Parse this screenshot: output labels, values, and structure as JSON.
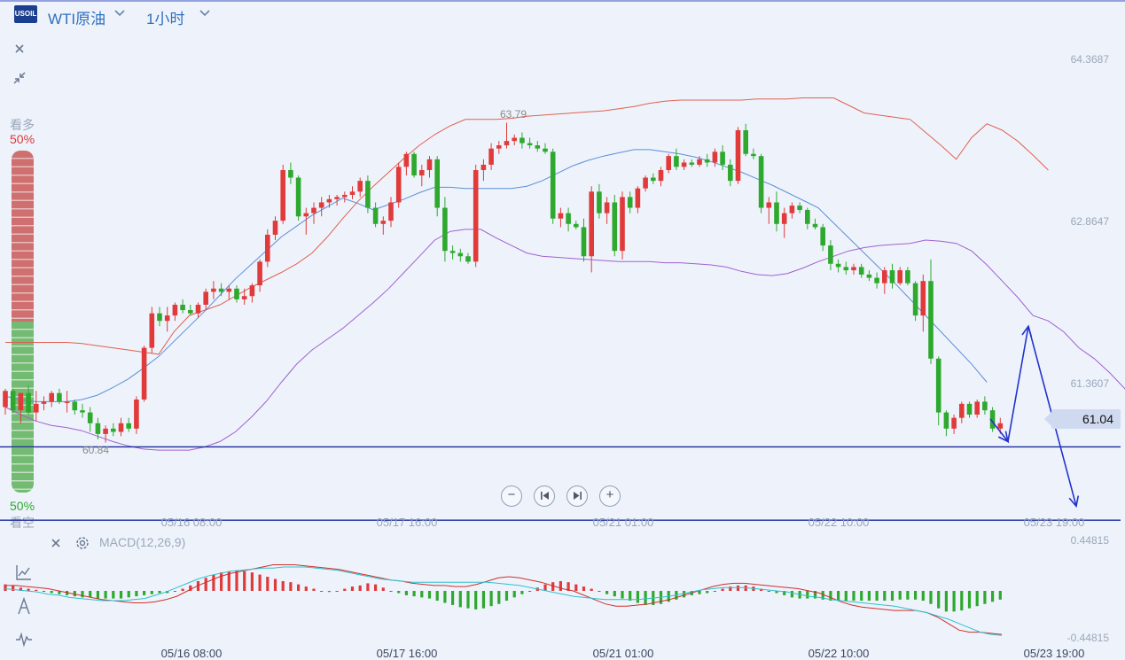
{
  "header": {
    "logo_text": "USOIL",
    "symbol": "WTI原油",
    "timeframe": "1小时"
  },
  "sentiment": {
    "bull_label": "看多",
    "bull_pct": "50%",
    "bear_label": "看空",
    "bear_pct": "50%",
    "bull_fraction": 0.5,
    "bull_color": "#c94040",
    "bear_color": "#3aa83a"
  },
  "price_tag": "61.04",
  "macd": {
    "label": "MACD(12,26,9)",
    "y_top": "0.44815",
    "y_bottom": "-0.44815"
  },
  "colors": {
    "up": "#e03a3a",
    "down": "#2ea82e",
    "upper_band": "#e06050",
    "mid_band": "#5a8fd8",
    "lower_band": "#a060d0",
    "arrow": "#2233cc"
  },
  "chart_data": {
    "type": "candlestick",
    "x_tick_labels": [
      "05/16 08:00",
      "05/17 16:00",
      "05/21 01:00",
      "05/22 10:00",
      "05/23 19:00"
    ],
    "y_tick_labels": [
      "64.3687",
      "62.8647",
      "61.3607"
    ],
    "y_ticks": [
      64.3687,
      62.8647,
      61.3607
    ],
    "ylim": [
      60.2,
      64.6
    ],
    "annotations": [
      {
        "text": "63.79",
        "value": 63.79
      },
      {
        "text": "60.84",
        "value": 60.84
      }
    ],
    "candles": [
      [
        61.15,
        61.32,
        61.08,
        61.3
      ],
      [
        61.3,
        61.32,
        61.1,
        61.12
      ],
      [
        61.12,
        61.28,
        61.0,
        61.28
      ],
      [
        61.28,
        61.35,
        61.08,
        61.1
      ],
      [
        61.1,
        61.3,
        61.02,
        61.18
      ],
      [
        61.18,
        61.25,
        61.12,
        61.2
      ],
      [
        61.2,
        61.3,
        61.15,
        61.28
      ],
      [
        61.28,
        61.32,
        61.18,
        61.2
      ],
      [
        61.2,
        61.3,
        61.1,
        61.2
      ],
      [
        61.2,
        61.22,
        61.08,
        61.12
      ],
      [
        61.12,
        61.18,
        61.05,
        61.1
      ],
      [
        61.1,
        61.15,
        60.92,
        61.0
      ],
      [
        61.0,
        61.05,
        60.85,
        60.9
      ],
      [
        60.9,
        60.98,
        60.82,
        60.95
      ],
      [
        60.95,
        61.0,
        60.88,
        60.92
      ],
      [
        60.92,
        61.05,
        60.88,
        61.0
      ],
      [
        61.0,
        61.05,
        60.92,
        60.95
      ],
      [
        60.95,
        61.25,
        60.9,
        61.22
      ],
      [
        61.22,
        61.72,
        61.2,
        61.7
      ],
      [
        61.7,
        62.08,
        61.65,
        62.02
      ],
      [
        62.02,
        62.08,
        61.9,
        61.95
      ],
      [
        61.95,
        62.08,
        61.85,
        62.0
      ],
      [
        62.0,
        62.12,
        61.95,
        62.1
      ],
      [
        62.1,
        62.15,
        62.02,
        62.05
      ],
      [
        62.05,
        62.1,
        62.0,
        62.02
      ],
      [
        62.02,
        62.12,
        61.98,
        62.1
      ],
      [
        62.1,
        62.25,
        62.05,
        62.22
      ],
      [
        62.22,
        62.32,
        62.15,
        62.25
      ],
      [
        62.25,
        62.3,
        62.18,
        62.22
      ],
      [
        62.22,
        62.28,
        62.15,
        62.25
      ],
      [
        62.25,
        62.28,
        62.12,
        62.15
      ],
      [
        62.15,
        62.25,
        62.1,
        62.18
      ],
      [
        62.18,
        62.3,
        62.12,
        62.28
      ],
      [
        62.28,
        62.52,
        62.22,
        62.5
      ],
      [
        62.5,
        62.8,
        62.45,
        62.75
      ],
      [
        62.75,
        62.92,
        62.7,
        62.88
      ],
      [
        62.88,
        63.4,
        62.85,
        63.35
      ],
      [
        63.35,
        63.42,
        63.22,
        63.28
      ],
      [
        63.28,
        63.3,
        62.88,
        62.92
      ],
      [
        62.92,
        63.0,
        62.75,
        62.95
      ],
      [
        62.95,
        63.05,
        62.85,
        63.0
      ],
      [
        63.0,
        63.1,
        62.92,
        63.05
      ],
      [
        63.05,
        63.12,
        63.0,
        63.08
      ],
      [
        63.08,
        63.12,
        63.02,
        63.1
      ],
      [
        63.1,
        63.15,
        63.05,
        63.12
      ],
      [
        63.12,
        63.2,
        63.08,
        63.15
      ],
      [
        63.15,
        63.28,
        63.1,
        63.25
      ],
      [
        63.25,
        63.3,
        62.95,
        63.0
      ],
      [
        63.0,
        63.05,
        62.82,
        62.85
      ],
      [
        62.85,
        62.92,
        62.75,
        62.88
      ],
      [
        62.88,
        63.1,
        62.82,
        63.05
      ],
      [
        63.05,
        63.42,
        63.0,
        63.38
      ],
      [
        63.38,
        63.52,
        63.3,
        63.5
      ],
      [
        63.5,
        63.52,
        63.28,
        63.3
      ],
      [
        63.3,
        63.4,
        63.2,
        63.35
      ],
      [
        63.35,
        63.48,
        63.28,
        63.45
      ],
      [
        63.45,
        63.48,
        62.92,
        63.0
      ],
      [
        63.0,
        63.1,
        62.5,
        62.6
      ],
      [
        62.6,
        62.65,
        62.52,
        62.58
      ],
      [
        62.58,
        62.62,
        62.5,
        62.55
      ],
      [
        62.55,
        62.58,
        62.48,
        62.5
      ],
      [
        62.5,
        63.4,
        62.45,
        63.35
      ],
      [
        63.35,
        63.45,
        63.25,
        63.4
      ],
      [
        63.4,
        63.6,
        63.35,
        63.55
      ],
      [
        63.55,
        63.62,
        63.5,
        63.58
      ],
      [
        63.58,
        63.79,
        63.55,
        63.62
      ],
      [
        63.62,
        63.68,
        63.58,
        63.65
      ],
      [
        63.65,
        63.7,
        63.55,
        63.6
      ],
      [
        63.6,
        63.65,
        63.55,
        63.58
      ],
      [
        63.58,
        63.62,
        63.52,
        63.55
      ],
      [
        63.55,
        63.6,
        63.5,
        63.52
      ],
      [
        63.52,
        63.55,
        62.85,
        62.9
      ],
      [
        62.9,
        63.0,
        62.82,
        62.95
      ],
      [
        62.95,
        63.0,
        62.78,
        62.85
      ],
      [
        62.85,
        62.88,
        62.8,
        62.82
      ],
      [
        62.82,
        62.9,
        62.5,
        62.55
      ],
      [
        62.55,
        63.2,
        62.4,
        63.15
      ],
      [
        63.15,
        63.22,
        62.9,
        62.95
      ],
      [
        62.95,
        63.1,
        62.85,
        63.05
      ],
      [
        63.05,
        63.12,
        62.55,
        62.6
      ],
      [
        62.6,
        63.15,
        62.52,
        63.1
      ],
      [
        63.1,
        63.15,
        62.95,
        63.0
      ],
      [
        63.0,
        63.2,
        62.95,
        63.18
      ],
      [
        63.18,
        63.3,
        63.15,
        63.28
      ],
      [
        63.28,
        63.32,
        63.22,
        63.25
      ],
      [
        63.25,
        63.38,
        63.2,
        63.35
      ],
      [
        63.35,
        63.5,
        63.32,
        63.48
      ],
      [
        63.48,
        63.55,
        63.35,
        63.38
      ],
      [
        63.38,
        63.45,
        63.35,
        63.42
      ],
      [
        63.42,
        63.45,
        63.38,
        63.4
      ],
      [
        63.4,
        63.48,
        63.38,
        63.45
      ],
      [
        63.45,
        63.5,
        63.38,
        63.42
      ],
      [
        63.42,
        63.55,
        63.38,
        63.52
      ],
      [
        63.52,
        63.58,
        63.35,
        63.4
      ],
      [
        63.4,
        63.45,
        63.2,
        63.25
      ],
      [
        63.25,
        63.75,
        63.22,
        63.72
      ],
      [
        63.72,
        63.78,
        63.48,
        63.5
      ],
      [
        63.5,
        63.55,
        63.45,
        63.48
      ],
      [
        63.48,
        63.5,
        62.95,
        63.0
      ],
      [
        63.0,
        63.1,
        62.85,
        63.05
      ],
      [
        63.05,
        63.15,
        62.78,
        62.85
      ],
      [
        62.85,
        63.0,
        62.72,
        62.95
      ],
      [
        62.95,
        63.05,
        62.9,
        63.02
      ],
      [
        63.02,
        63.05,
        62.95,
        62.98
      ],
      [
        62.98,
        63.0,
        62.8,
        62.85
      ],
      [
        62.85,
        62.9,
        62.8,
        62.82
      ],
      [
        62.82,
        62.85,
        62.6,
        62.65
      ],
      [
        62.65,
        62.7,
        62.42,
        62.48
      ],
      [
        62.48,
        62.52,
        62.4,
        62.45
      ],
      [
        62.45,
        62.5,
        62.38,
        62.42
      ],
      [
        62.42,
        62.48,
        62.38,
        62.45
      ],
      [
        62.45,
        62.48,
        62.35,
        62.38
      ],
      [
        62.38,
        62.42,
        62.32,
        62.35
      ],
      [
        62.35,
        62.4,
        62.25,
        62.3
      ],
      [
        62.3,
        62.45,
        62.2,
        62.42
      ],
      [
        62.42,
        62.48,
        62.25,
        62.3
      ],
      [
        62.3,
        62.45,
        62.28,
        62.42
      ],
      [
        62.42,
        62.45,
        62.28,
        62.3
      ],
      [
        62.3,
        62.32,
        61.95,
        62.0
      ],
      [
        62.0,
        62.38,
        61.85,
        62.32
      ],
      [
        62.32,
        62.52,
        61.55,
        61.6
      ],
      [
        61.6,
        61.62,
        60.98,
        61.1
      ],
      [
        61.1,
        61.12,
        60.88,
        60.95
      ],
      [
        60.95,
        61.08,
        60.9,
        61.05
      ],
      [
        61.05,
        61.2,
        61.0,
        61.18
      ],
      [
        61.18,
        61.2,
        61.05,
        61.08
      ],
      [
        61.08,
        61.22,
        61.05,
        61.2
      ],
      [
        61.2,
        61.25,
        61.08,
        61.12
      ],
      [
        61.12,
        61.15,
        60.92,
        60.95
      ],
      [
        60.95,
        61.05,
        60.9,
        61.0
      ]
    ],
    "upper_band": [
      61.75,
      61.75,
      61.75,
      61.75,
      61.75,
      61.74,
      61.72,
      61.7,
      61.68,
      61.66,
      61.64,
      61.85,
      62.0,
      62.05,
      62.1,
      62.18,
      62.26,
      62.33,
      62.4,
      62.48,
      62.58,
      62.73,
      62.9,
      63.06,
      63.2,
      63.33,
      63.46,
      63.58,
      63.68,
      63.76,
      63.82,
      63.82,
      63.82,
      63.83,
      63.85,
      63.86,
      63.87,
      63.88,
      63.89,
      63.9,
      63.92,
      63.94,
      63.97,
      63.99,
      64.0,
      64.0,
      64.0,
      64.0,
      64.0,
      64.01,
      64.01,
      64.01,
      64.02,
      64.02,
      64.02,
      63.95,
      63.88,
      63.86,
      63.84,
      63.82,
      63.7,
      63.58,
      63.45,
      63.65,
      63.78,
      63.72,
      63.62,
      63.49,
      63.35
    ],
    "mid_band": [
      61.25,
      61.22,
      61.2,
      61.2,
      61.2,
      61.22,
      61.26,
      61.33,
      61.41,
      61.51,
      61.62,
      61.76,
      61.9,
      62.04,
      62.19,
      62.34,
      62.47,
      62.6,
      62.73,
      62.83,
      62.93,
      63.01,
      63.09,
      63.04,
      62.98,
      63.03,
      63.08,
      63.14,
      63.19,
      63.19,
      63.18,
      63.18,
      63.18,
      63.18,
      63.2,
      63.25,
      63.32,
      63.39,
      63.44,
      63.48,
      63.51,
      63.54,
      63.54,
      63.52,
      63.5,
      63.47,
      63.43,
      63.38,
      63.33,
      63.27,
      63.21,
      63.14,
      63.07,
      63.0,
      62.86,
      62.72,
      62.58,
      62.44,
      62.3,
      62.15,
      62.0,
      61.85,
      61.7,
      61.55,
      61.38
    ],
    "lower_band": [
      61.15,
      61.08,
      61.02,
      60.98,
      60.96,
      60.93,
      60.88,
      60.83,
      60.79,
      60.76,
      60.75,
      60.75,
      60.75,
      60.78,
      60.83,
      60.92,
      61.05,
      61.2,
      61.38,
      61.55,
      61.68,
      61.78,
      61.88,
      62.0,
      62.12,
      62.25,
      62.4,
      62.55,
      62.7,
      62.78,
      62.8,
      62.8,
      62.72,
      62.65,
      62.58,
      62.55,
      62.54,
      62.53,
      62.52,
      62.51,
      62.5,
      62.5,
      62.5,
      62.49,
      62.49,
      62.48,
      62.47,
      62.45,
      62.41,
      62.38,
      62.37,
      62.39,
      62.44,
      62.5,
      62.55,
      62.6,
      62.63,
      62.65,
      62.66,
      62.67,
      62.7,
      62.69,
      62.67,
      62.6,
      62.47,
      62.32,
      62.17,
      62.0,
      61.95,
      61.85,
      61.7,
      61.6,
      61.47,
      61.32,
      61.0,
      60.78,
      60.55
    ],
    "forecast_arrow": [
      [
        61.04,
        61.04
      ],
      [
        60.83,
        61.9
      ],
      [
        61.9,
        60.23
      ]
    ],
    "horizontal_lines": [
      60.78,
      60.1
    ],
    "macd": {
      "ylim": [
        -0.44815,
        0.44815
      ],
      "histogram": [
        0.06,
        0.05,
        0.03,
        0.02,
        0.01,
        0.0,
        -0.02,
        -0.03,
        -0.04,
        -0.05,
        -0.06,
        -0.06,
        -0.07,
        -0.07,
        -0.07,
        -0.07,
        -0.06,
        -0.05,
        -0.04,
        -0.03,
        -0.02,
        -0.02,
        0.0,
        0.02,
        0.05,
        0.09,
        0.12,
        0.15,
        0.17,
        0.18,
        0.19,
        0.18,
        0.17,
        0.15,
        0.13,
        0.11,
        0.09,
        0.08,
        0.06,
        0.04,
        0.02,
        0.0,
        -0.01,
        0.0,
        0.02,
        0.04,
        0.05,
        0.07,
        0.06,
        0.03,
        0.0,
        -0.02,
        -0.04,
        -0.05,
        -0.06,
        -0.07,
        -0.09,
        -0.11,
        -0.13,
        -0.15,
        -0.16,
        -0.17,
        -0.16,
        -0.14,
        -0.12,
        -0.09,
        -0.06,
        -0.03,
        0.0,
        0.03,
        0.06,
        0.08,
        0.09,
        0.08,
        0.06,
        0.04,
        0.02,
        0.0,
        -0.03,
        -0.05,
        -0.07,
        -0.09,
        -0.11,
        -0.13,
        -0.13,
        -0.12,
        -0.1,
        -0.08,
        -0.06,
        -0.04,
        -0.03,
        -0.02,
        0.0,
        0.02,
        0.04,
        0.05,
        0.05,
        0.04,
        0.02,
        0.0,
        -0.02,
        -0.04,
        -0.06,
        -0.07,
        -0.07,
        -0.07,
        -0.08,
        -0.09,
        -0.09,
        -0.09,
        -0.09,
        -0.09,
        -0.09,
        -0.09,
        -0.09,
        -0.09,
        -0.08,
        -0.08,
        -0.08,
        -0.09,
        -0.12,
        -0.16,
        -0.19,
        -0.19,
        -0.18,
        -0.16,
        -0.14,
        -0.12,
        -0.1,
        -0.08
      ],
      "macd_line": [
        0.05,
        0.05,
        0.04,
        0.03,
        0.02,
        0.0,
        -0.02,
        -0.04,
        -0.06,
        -0.08,
        -0.09,
        -0.1,
        -0.11,
        -0.11,
        -0.1,
        -0.08,
        -0.05,
        0.0,
        0.05,
        0.09,
        0.13,
        0.16,
        0.18,
        0.2,
        0.22,
        0.24,
        0.24,
        0.24,
        0.23,
        0.22,
        0.21,
        0.2,
        0.18,
        0.16,
        0.14,
        0.12,
        0.1,
        0.09,
        0.07,
        0.06,
        0.05,
        0.05,
        0.04,
        0.04,
        0.06,
        0.09,
        0.12,
        0.13,
        0.12,
        0.1,
        0.08,
        0.05,
        0.02,
        0.0,
        -0.04,
        -0.08,
        -0.12,
        -0.14,
        -0.14,
        -0.13,
        -0.12,
        -0.1,
        -0.08,
        -0.05,
        -0.02,
        0.01,
        0.04,
        0.06,
        0.07,
        0.07,
        0.06,
        0.05,
        0.04,
        0.03,
        0.02,
        0.0,
        -0.02,
        -0.06,
        -0.1,
        -0.13,
        -0.15,
        -0.16,
        -0.17,
        -0.18,
        -0.18,
        -0.18,
        -0.2,
        -0.24,
        -0.3,
        -0.36,
        -0.38,
        -0.38,
        -0.39,
        -0.4
      ],
      "signal_line": [
        0.02,
        0.01,
        0.0,
        -0.01,
        -0.03,
        -0.04,
        -0.06,
        -0.07,
        -0.08,
        -0.09,
        -0.09,
        -0.09,
        -0.08,
        -0.07,
        -0.04,
        -0.01,
        0.03,
        0.07,
        0.11,
        0.14,
        0.16,
        0.18,
        0.19,
        0.2,
        0.21,
        0.21,
        0.22,
        0.22,
        0.22,
        0.21,
        0.2,
        0.19,
        0.17,
        0.15,
        0.13,
        0.11,
        0.1,
        0.09,
        0.08,
        0.08,
        0.08,
        0.08,
        0.08,
        0.08,
        0.08,
        0.08,
        0.07,
        0.06,
        0.05,
        0.03,
        0.01,
        -0.01,
        -0.03,
        -0.05,
        -0.06,
        -0.07,
        -0.08,
        -0.08,
        -0.08,
        -0.08,
        -0.07,
        -0.06,
        -0.05,
        -0.03,
        -0.01,
        0.01,
        0.02,
        0.03,
        0.03,
        0.03,
        0.02,
        0.01,
        0.0,
        -0.01,
        -0.03,
        -0.05,
        -0.06,
        -0.08,
        -0.09,
        -0.1,
        -0.11,
        -0.12,
        -0.13,
        -0.14,
        -0.16,
        -0.18,
        -0.2,
        -0.23,
        -0.26,
        -0.3,
        -0.34,
        -0.38,
        -0.4,
        -0.41
      ]
    }
  }
}
